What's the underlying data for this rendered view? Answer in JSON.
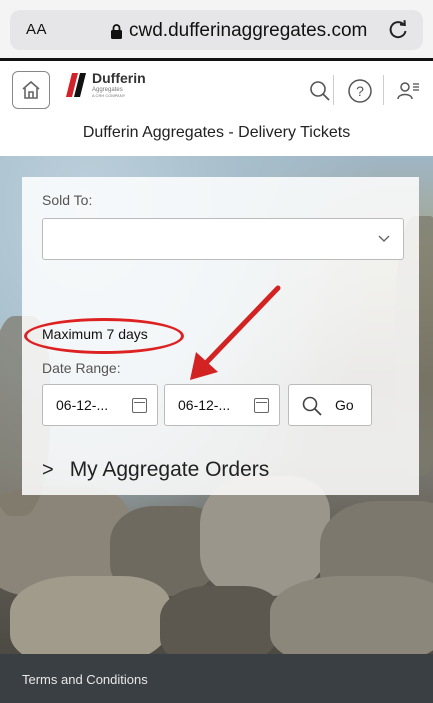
{
  "browser": {
    "text_size_label": "AA",
    "url": "cwd.dufferinaggregates.com"
  },
  "header": {
    "logo_name": "Dufferin",
    "logo_sub": "Aggregates",
    "logo_tagline": "A CRH COMPANY",
    "page_title": "Dufferin Aggregates - Delivery Tickets",
    "icons": [
      "home-icon",
      "search-icon",
      "help-icon",
      "user-menu-icon"
    ]
  },
  "form": {
    "sold_to_label": "Sold To:",
    "sold_to_value": "",
    "hint": "Maximum 7 days",
    "date_range_label": "Date Range:",
    "date_from": "06-12-...",
    "date_to": "06-12-...",
    "go_label": "Go"
  },
  "orders": {
    "label": "My Aggregate Orders"
  },
  "footer": {
    "link": "Terms and Conditions"
  },
  "colors": {
    "annotation": "#d22222",
    "footer_bg": "#3a3f44",
    "logo_red": "#d3222a"
  }
}
